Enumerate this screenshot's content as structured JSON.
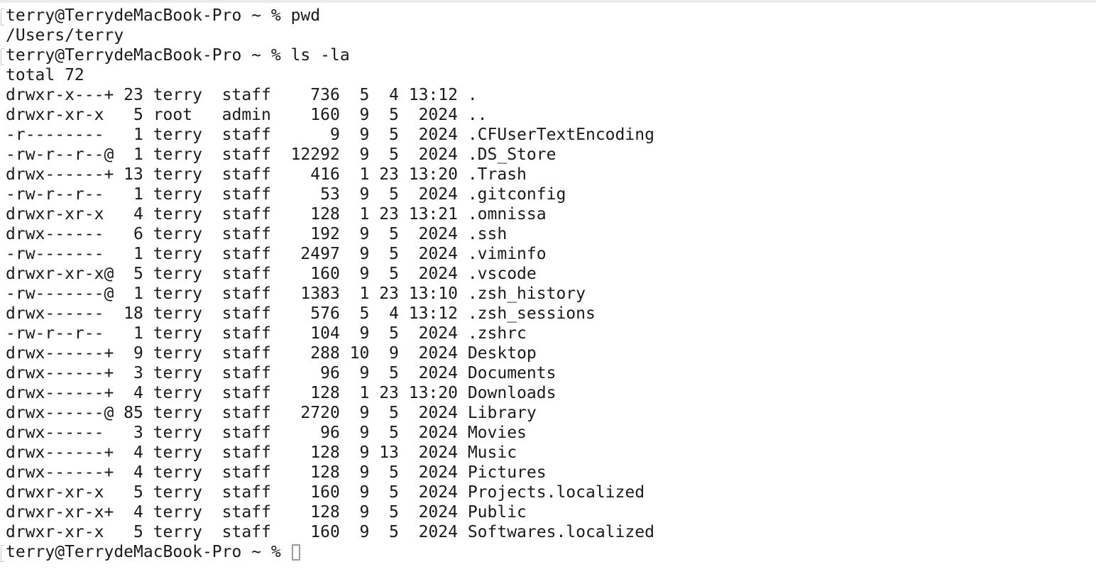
{
  "terminal": {
    "lines": [
      {
        "kind": "prompt",
        "prompt": "terry@TerrydeMacBook-Pro ~ % ",
        "command": "pwd"
      },
      {
        "kind": "output",
        "text": "/Users/terry"
      },
      {
        "kind": "prompt",
        "prompt": "terry@TerrydeMacBook-Pro ~ % ",
        "command": "ls -la"
      },
      {
        "kind": "output",
        "text": "total 72"
      },
      {
        "kind": "output",
        "text": "drwxr-x---+ 23 terry  staff    736  5  4 13:12 ."
      },
      {
        "kind": "output",
        "text": "drwxr-xr-x   5 root   admin    160  9  5  2024 .."
      },
      {
        "kind": "output",
        "text": "-r--------   1 terry  staff      9  9  5  2024 .CFUserTextEncoding"
      },
      {
        "kind": "output",
        "text": "-rw-r--r--@  1 terry  staff  12292  9  5  2024 .DS_Store"
      },
      {
        "kind": "output",
        "text": "drwx------+ 13 terry  staff    416  1 23 13:20 .Trash"
      },
      {
        "kind": "output",
        "text": "-rw-r--r--   1 terry  staff     53  9  5  2024 .gitconfig"
      },
      {
        "kind": "output",
        "text": "drwxr-xr-x   4 terry  staff    128  1 23 13:21 .omnissa"
      },
      {
        "kind": "output",
        "text": "drwx------   6 terry  staff    192  9  5  2024 .ssh"
      },
      {
        "kind": "output",
        "text": "-rw-------   1 terry  staff   2497  9  5  2024 .viminfo"
      },
      {
        "kind": "output",
        "text": "drwxr-xr-x@  5 terry  staff    160  9  5  2024 .vscode"
      },
      {
        "kind": "output",
        "text": "-rw-------@  1 terry  staff   1383  1 23 13:10 .zsh_history"
      },
      {
        "kind": "output",
        "text": "drwx------  18 terry  staff    576  5  4 13:12 .zsh_sessions"
      },
      {
        "kind": "output",
        "text": "-rw-r--r--   1 terry  staff    104  9  5  2024 .zshrc"
      },
      {
        "kind": "output",
        "text": "drwx------+  9 terry  staff    288 10  9  2024 Desktop"
      },
      {
        "kind": "output",
        "text": "drwx------+  3 terry  staff     96  9  5  2024 Documents"
      },
      {
        "kind": "output",
        "text": "drwx------+  4 terry  staff    128  1 23 13:20 Downloads"
      },
      {
        "kind": "output",
        "text": "drwx------@ 85 terry  staff   2720  9  5  2024 Library"
      },
      {
        "kind": "output",
        "text": "drwx------   3 terry  staff     96  9  5  2024 Movies"
      },
      {
        "kind": "output",
        "text": "drwx------+  4 terry  staff    128  9 13  2024 Music"
      },
      {
        "kind": "output",
        "text": "drwx------+  4 terry  staff    128  9  5  2024 Pictures"
      },
      {
        "kind": "output",
        "text": "drwxr-xr-x   5 terry  staff    160  9  5  2024 Projects.localized"
      },
      {
        "kind": "output",
        "text": "drwxr-xr-x+  4 terry  staff    128  9  5  2024 Public"
      },
      {
        "kind": "output",
        "text": "drwxr-xr-x   5 terry  staff    160  9  5  2024 Softwares.localized"
      },
      {
        "kind": "prompt",
        "prompt": "terry@TerrydeMacBook-Pro ~ % ",
        "command": "",
        "cursor": true
      }
    ]
  }
}
